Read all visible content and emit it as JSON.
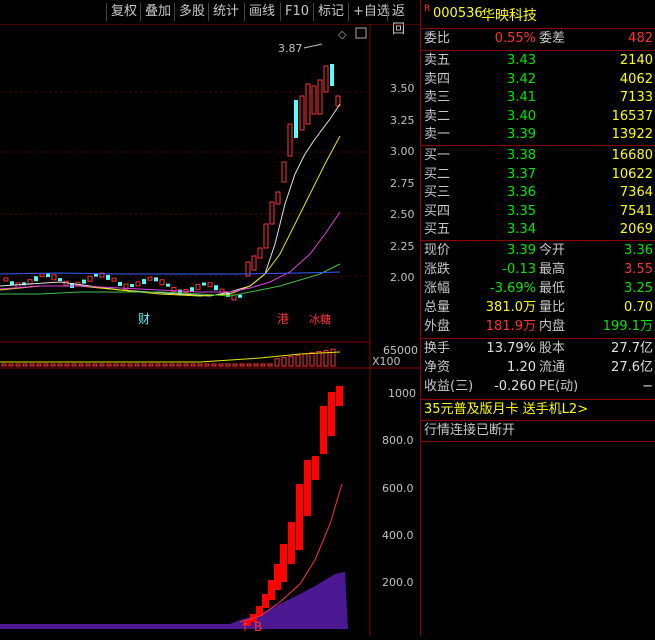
{
  "toolbar": [
    "复权",
    "叠加",
    "多股",
    "统计",
    "画线",
    "F10",
    "标记",
    "+自选",
    "返回"
  ],
  "stock": {
    "badge": "R",
    "code": "000536",
    "name": "华映科技"
  },
  "weibi": {
    "label": "委比",
    "value": "0.55%",
    "label2": "委差",
    "value2": "482"
  },
  "sell": [
    {
      "label": "卖五",
      "price": "3.43",
      "vol": "2140"
    },
    {
      "label": "卖四",
      "price": "3.42",
      "vol": "4062"
    },
    {
      "label": "卖三",
      "price": "3.41",
      "vol": "7133"
    },
    {
      "label": "卖二",
      "price": "3.40",
      "vol": "16537"
    },
    {
      "label": "卖一",
      "price": "3.39",
      "vol": "13922"
    }
  ],
  "buy": [
    {
      "label": "买一",
      "price": "3.38",
      "vol": "16680"
    },
    {
      "label": "买二",
      "price": "3.37",
      "vol": "10622"
    },
    {
      "label": "买三",
      "price": "3.36",
      "vol": "7364"
    },
    {
      "label": "买四",
      "price": "3.35",
      "vol": "7541"
    },
    {
      "label": "买五",
      "price": "3.34",
      "vol": "2069"
    }
  ],
  "quote": [
    {
      "l1": "现价",
      "v1": "3.39",
      "l2": "今开",
      "v2": "3.36"
    },
    {
      "l1": "涨跌",
      "v1": "-0.13",
      "l2": "最高",
      "v2": "3.55"
    },
    {
      "l1": "涨幅",
      "v1": "-3.69%",
      "l2": "最低",
      "v2": "3.25"
    },
    {
      "l1": "总量",
      "v1": "381.0万",
      "l2": "量比",
      "v2": "0.70"
    },
    {
      "l1": "外盘",
      "v1": "181.9万",
      "l2": "内盘",
      "v2": "199.1万"
    }
  ],
  "stats": [
    {
      "l1": "换手",
      "v1": "13.79%",
      "l2": "股本",
      "v2": "27.7亿"
    },
    {
      "l1": "净资",
      "v1": "1.20",
      "l2": "流通",
      "v2": "27.6亿"
    },
    {
      "l1": "收益(三)",
      "v1": "-0.260",
      "l2": "PE(动)",
      "v2": "−"
    }
  ],
  "promo": "35元普及版月卡 送手机L2>",
  "status": "行情连接已断开",
  "chart": {
    "price_axis": [
      "3.50",
      "3.25",
      "3.00",
      "2.75",
      "2.50",
      "2.25",
      "2.00"
    ],
    "high_label": "3.87",
    "markers": [
      "财",
      "港",
      "冰",
      "糖"
    ],
    "vol_label": "65000",
    "vol_unit": "X100",
    "ind_axis": [
      "1000",
      "800.0",
      "600.0",
      "400.0",
      "200.0"
    ],
    "signal_label": "B"
  },
  "colors": {
    "up": "#ff3232",
    "down": "#54ffff",
    "text": "#c8c8c8",
    "frame": "#8b0000",
    "volbar": "#5a1aa0"
  }
}
